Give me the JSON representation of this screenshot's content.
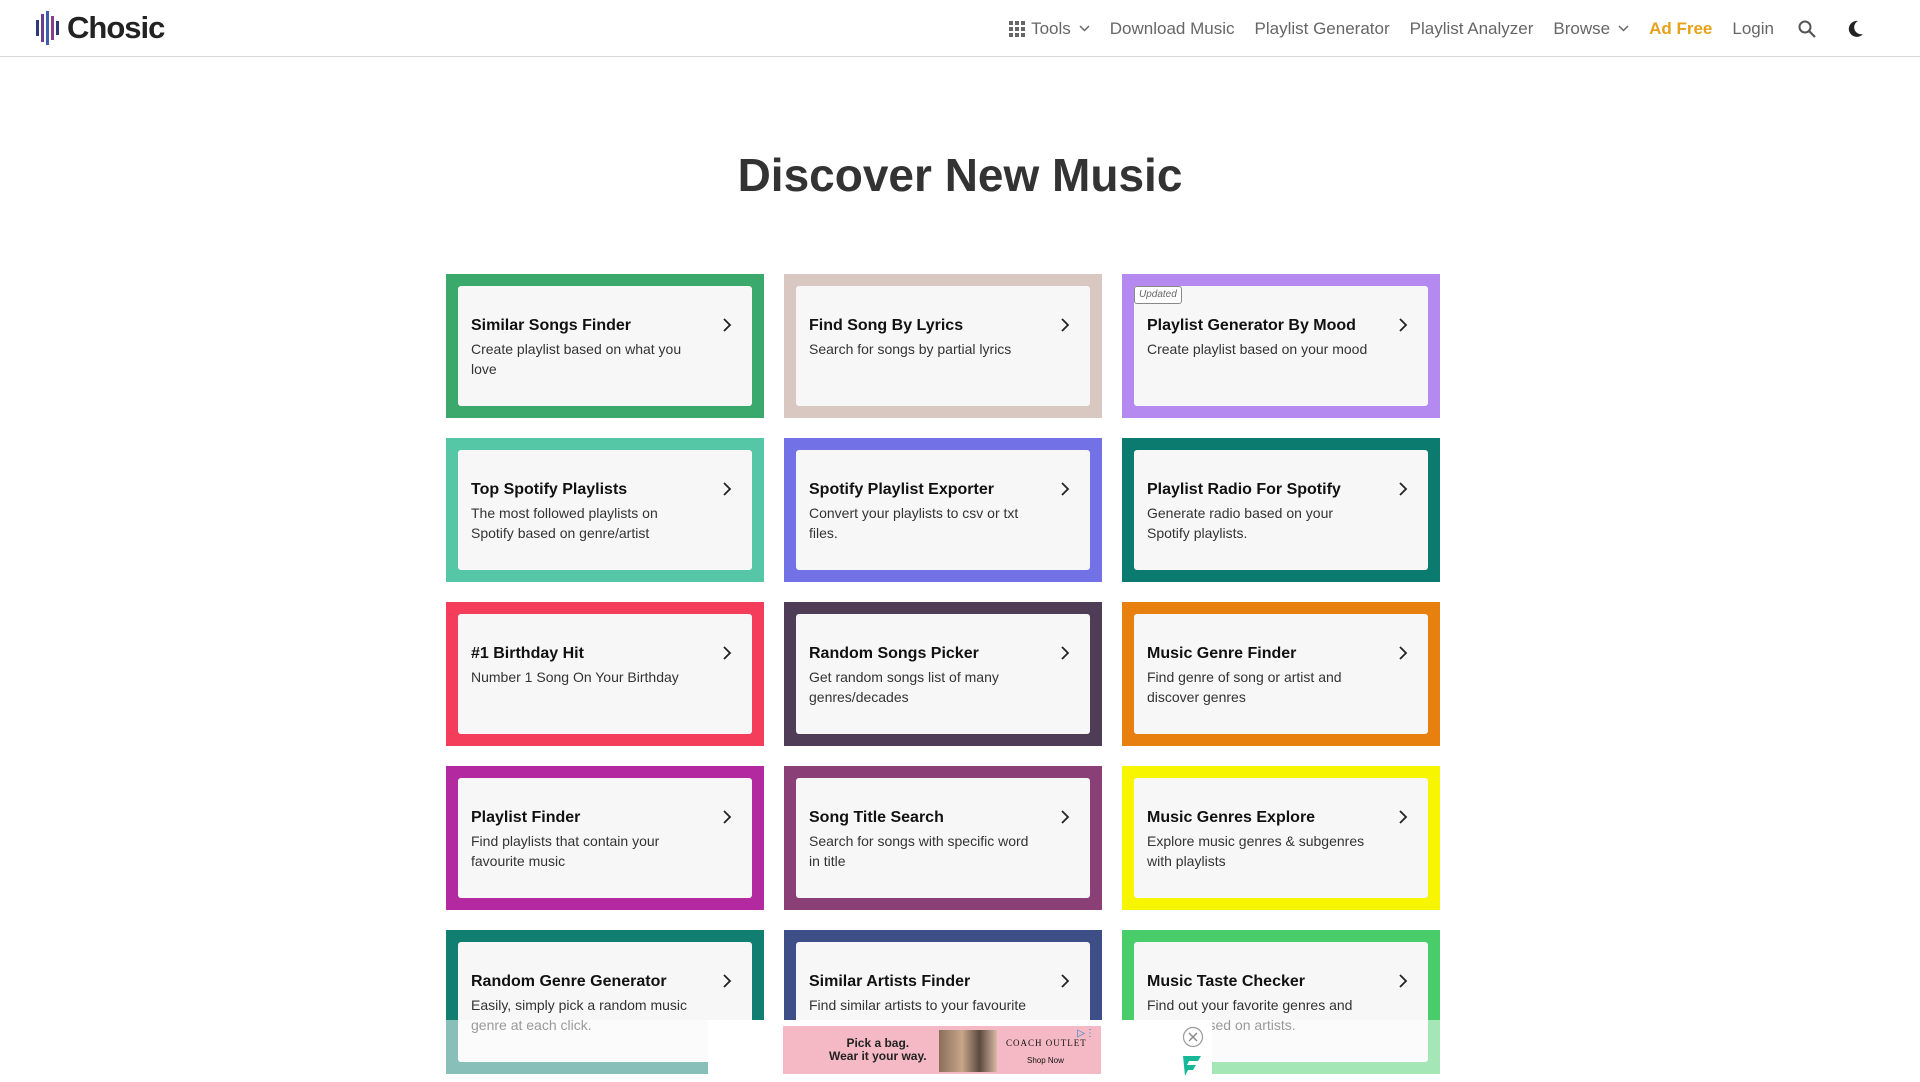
{
  "header": {
    "logo_text": "Chosic",
    "nav": {
      "tools": "Tools",
      "download_music": "Download Music",
      "playlist_generator": "Playlist Generator",
      "playlist_analyzer": "Playlist Analyzer",
      "browse": "Browse",
      "ad_free": "Ad Free",
      "login": "Login"
    }
  },
  "page_title": "Discover New Music",
  "cards": [
    {
      "title": "Similar Songs Finder",
      "desc": "Create playlist based on what you love",
      "color": "#3aa96b"
    },
    {
      "title": "Find Song By Lyrics",
      "desc": "Search for songs by partial lyrics",
      "color": "#d8c8c1"
    },
    {
      "title": "Playlist Generator By Mood",
      "desc": "Create playlist based on your mood",
      "color": "#b58af0",
      "badge": "Updated"
    },
    {
      "title": "Top Spotify Playlists",
      "desc": "The most followed playlists on Spotify based on genre/artist",
      "color": "#55c7a6"
    },
    {
      "title": "Spotify Playlist Exporter",
      "desc": "Convert your playlists to csv or txt files.",
      "color": "#7272e6"
    },
    {
      "title": "Playlist Radio For Spotify",
      "desc": "Generate radio based on your Spotify playlists.",
      "color": "#0b7a6f"
    },
    {
      "title": "#1 Birthday Hit",
      "desc": "Number 1 Song On Your Birthday",
      "color": "#f43d5a"
    },
    {
      "title": "Random Songs Picker",
      "desc": "Get random songs list of many genres/decades",
      "color": "#4f3c57"
    },
    {
      "title": "Music Genre Finder",
      "desc": "Find genre of song or artist and discover genres",
      "color": "#e7800f"
    },
    {
      "title": "Playlist Finder",
      "desc": "Find playlists that contain your favourite music",
      "color": "#b32aa0"
    },
    {
      "title": "Song Title Search",
      "desc": "Search for songs with specific word in title",
      "color": "#8a3f76"
    },
    {
      "title": "Music Genres Explore",
      "desc": "Explore music genres & subgenres with playlists",
      "color": "#f8f500"
    },
    {
      "title": "Random Genre Generator",
      "desc": "Easily, simply pick a random music genre at each click.",
      "color": "#107e70"
    },
    {
      "title": "Similar Artists Finder",
      "desc": "Find similar artists to your favourite one",
      "color": "#3d4f86"
    },
    {
      "title": "Music Taste Checker",
      "desc": "Find out your favorite genres and moods based on artists.",
      "color": "#49cd6b"
    }
  ],
  "ad": {
    "line1": "Pick a bag.",
    "line2": "Wear it your way.",
    "brand": "COACH OUTLET",
    "cta": "Shop Now"
  }
}
